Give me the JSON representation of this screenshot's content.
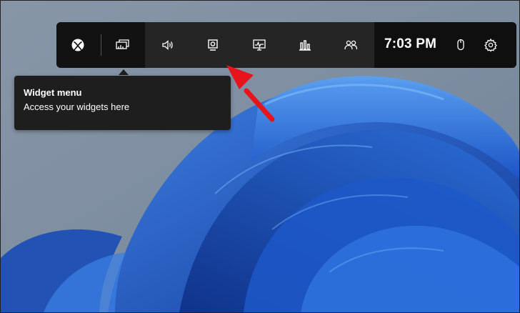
{
  "game_bar": {
    "buttons": [
      {
        "name": "xbox-icon"
      },
      {
        "name": "widget-menu-icon"
      },
      {
        "name": "audio-icon"
      },
      {
        "name": "capture-icon"
      },
      {
        "name": "performance-icon"
      },
      {
        "name": "resources-icon"
      },
      {
        "name": "xbox-social-icon"
      },
      {
        "name": "mouse-icon"
      },
      {
        "name": "gear-icon"
      }
    ],
    "clock": "7:03 PM"
  },
  "tooltip": {
    "title": "Widget menu",
    "description": "Access your widgets here"
  },
  "colors": {
    "annotation_arrow": "#e8141c",
    "bar_background": "#1c1c1c",
    "bar_highlight": "#252525",
    "tooltip_background": "#1e1e1e"
  }
}
